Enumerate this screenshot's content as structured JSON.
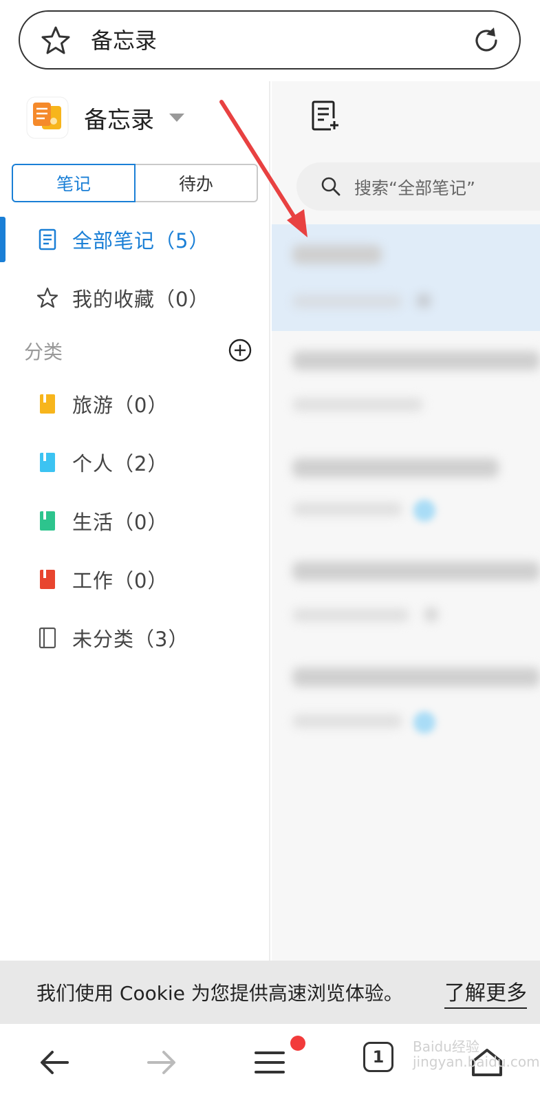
{
  "browser": {
    "title": "备忘录",
    "icons": {
      "bookmark": "star-icon",
      "reload": "reload-icon"
    }
  },
  "sidebar": {
    "app_name": "备忘录",
    "tabs": [
      {
        "label": "笔记",
        "selected": true
      },
      {
        "label": "待办",
        "selected": false
      }
    ],
    "main_items": [
      {
        "label": "全部笔记（5）",
        "icon": "document-icon",
        "active": true
      },
      {
        "label": "我的收藏（0）",
        "icon": "star-outline-icon",
        "active": false
      }
    ],
    "section_label": "分类",
    "categories": [
      {
        "label": "旅游（0）",
        "color": "#f7b51c"
      },
      {
        "label": "个人（2）",
        "color": "#3cc3f2"
      },
      {
        "label": "生活（0）",
        "color": "#2dc48d"
      },
      {
        "label": "工作（0）",
        "color": "#e8452f"
      },
      {
        "label": "未分类（3）",
        "color": "#555555"
      }
    ]
  },
  "content": {
    "search_placeholder": "搜索“全部笔记”"
  },
  "cookie_bar": {
    "message": "我们使用 Cookie 为您提供高速浏览体验。",
    "link": "了解更多"
  },
  "bottom_nav": {
    "tab_count": "1",
    "watermark": "Baidu经验\njingyan.baidu.com"
  },
  "colors": {
    "accent": "#1a7fd6",
    "badge": "#f23b3b",
    "arrow": "#e84141"
  }
}
